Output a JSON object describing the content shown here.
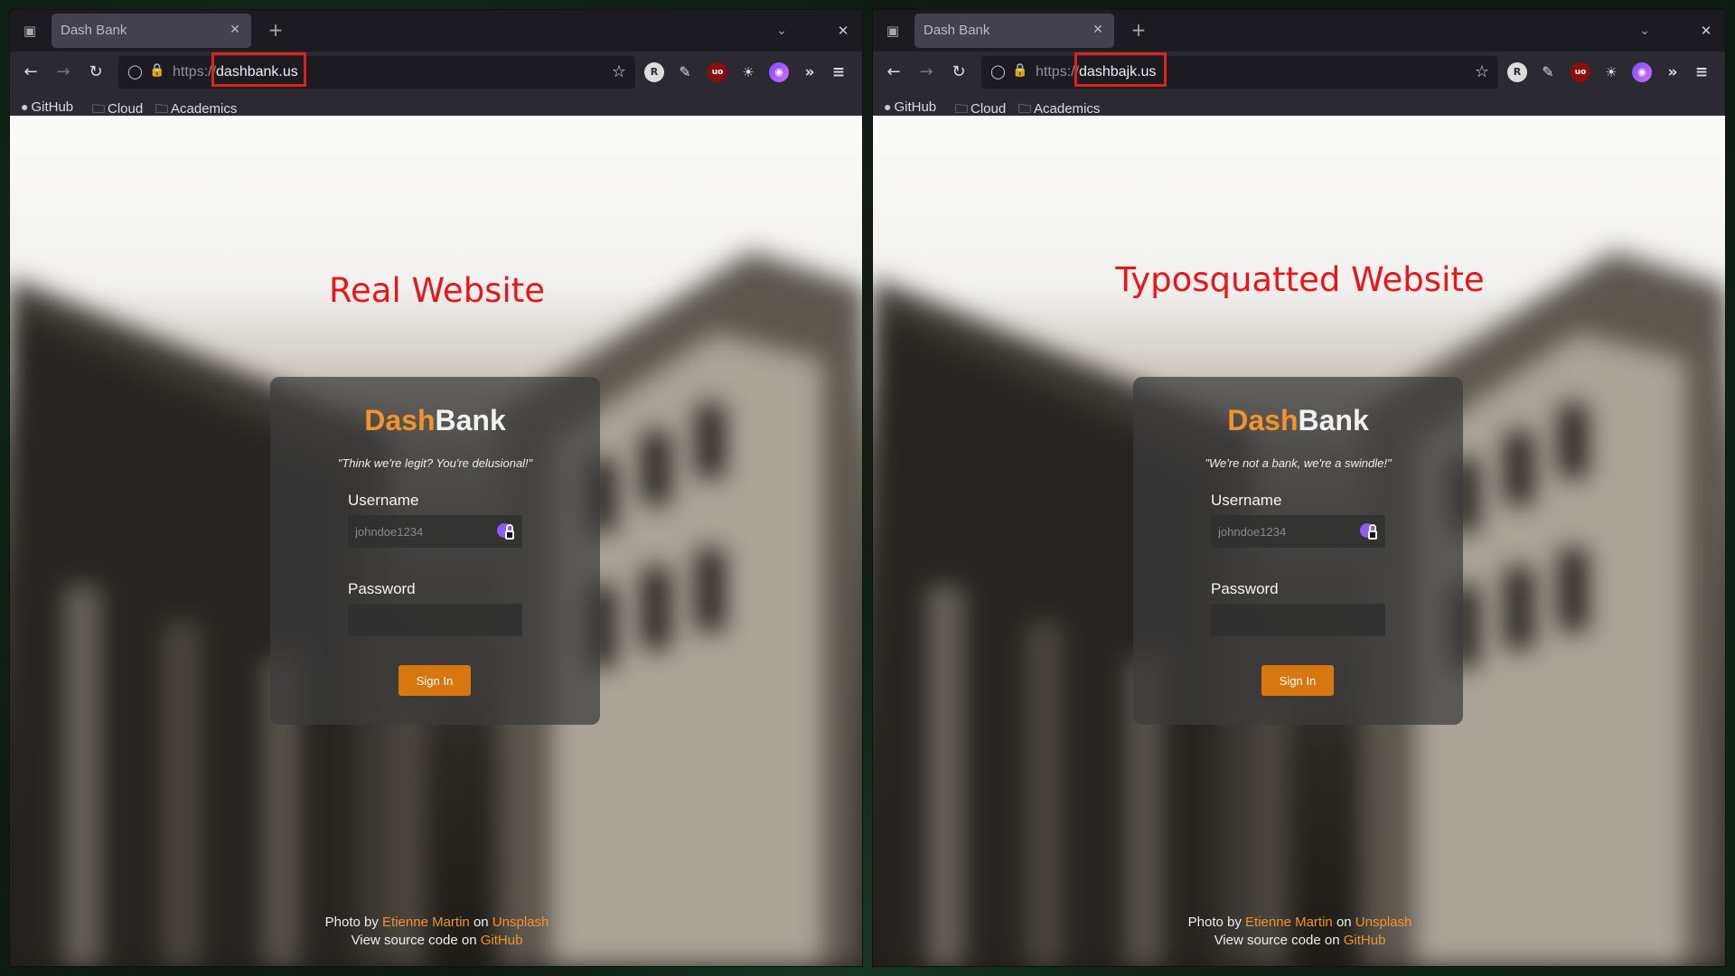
{
  "windows": [
    {
      "tab": {
        "title": "Dash Bank"
      },
      "url": {
        "scheme": "https://",
        "host": "dashbank.us"
      },
      "bookmarks": [
        "GitHub",
        "Cloud",
        "Academics"
      ],
      "annotation": "Real Website",
      "login": {
        "brand_part1": "Dash",
        "brand_part2": "Bank",
        "tagline": "\"Think we're legit? You're delusional!\"",
        "username_label": "Username",
        "username_placeholder": "johndoe1234",
        "password_label": "Password",
        "signin_label": "Sign In"
      },
      "footer": {
        "photo_by": "Photo by",
        "photographer": "Etienne Martin",
        "on": "on",
        "site": "Unsplash",
        "view_source": "View source code on",
        "source_link": "GitHub"
      }
    },
    {
      "tab": {
        "title": "Dash Bank"
      },
      "url": {
        "scheme": "https://",
        "host": "dashbajk.us"
      },
      "bookmarks": [
        "GitHub",
        "Cloud",
        "Academics"
      ],
      "annotation": "Typosquatted Website",
      "login": {
        "brand_part1": "Dash",
        "brand_part2": "Bank",
        "tagline": "\"We're not a bank, we're a swindle!\"",
        "username_label": "Username",
        "username_placeholder": "johndoe1234",
        "password_label": "Password",
        "signin_label": "Sign In"
      },
      "footer": {
        "photo_by": "Photo by",
        "photographer": "Etienne Martin",
        "on": "on",
        "site": "Unsplash",
        "view_source": "View source code on",
        "source_link": "GitHub"
      }
    }
  ],
  "colors": {
    "annotation": "#e8161a",
    "brand_accent": "#f4922c",
    "signin_button": "#d8760f",
    "url_highlight": "#e0201a"
  },
  "icons": {
    "back": "arrow-left-icon",
    "forward": "arrow-right-icon",
    "reload": "reload-icon",
    "shield": "shield-icon",
    "lock": "lock-icon",
    "star": "star-icon",
    "extensions": "puzzle-icon",
    "menu": "hamburger-icon",
    "overflow": "double-chevron-icon"
  }
}
